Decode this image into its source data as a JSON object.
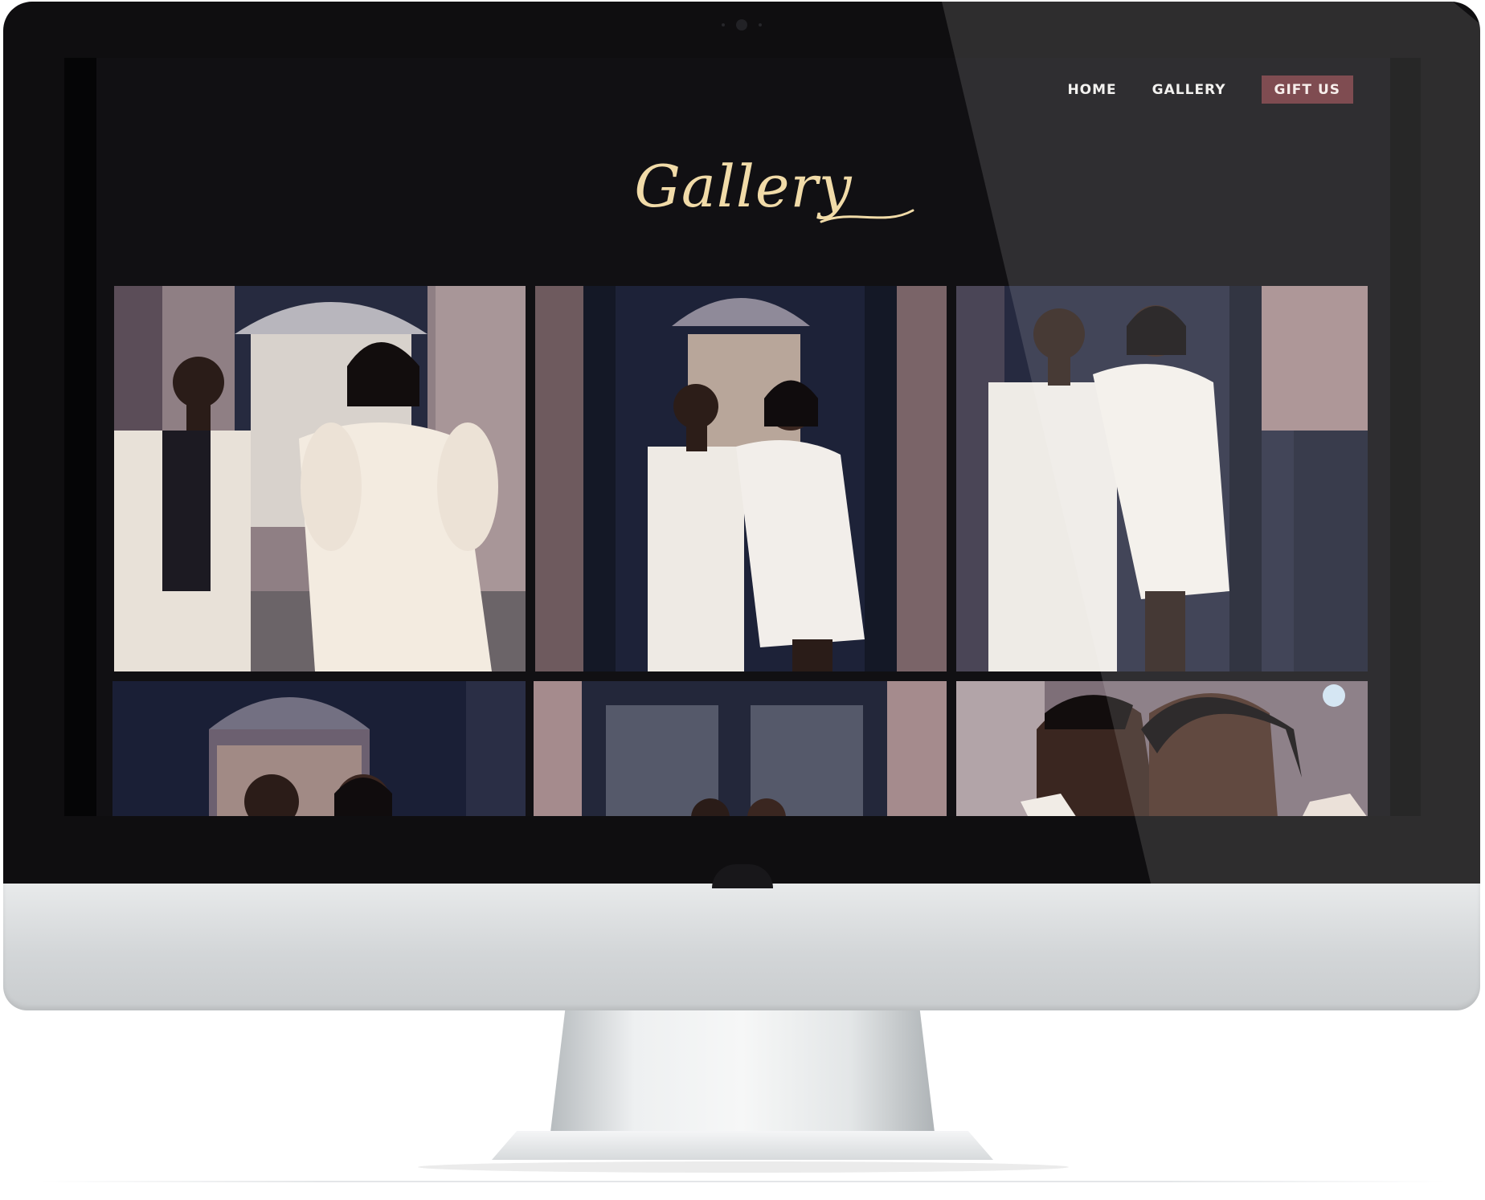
{
  "nav": {
    "links": [
      {
        "label": "HOME"
      },
      {
        "label": "GALLERY"
      }
    ],
    "cta": {
      "label": "GIFT US"
    }
  },
  "gallery": {
    "title": "Gallery",
    "title_color": "#f1dba8",
    "photos": [
      {
        "name": "couple-walking-hand-in-hand"
      },
      {
        "name": "couple-embrace-doorway"
      },
      {
        "name": "couple-standing-side-by-side"
      },
      {
        "name": "couple-portrait-doorway"
      },
      {
        "name": "couple-doorway-brick"
      },
      {
        "name": "couple-forehead-closeup"
      }
    ]
  },
  "colors": {
    "page_background": "#111013",
    "cta_background": "#6d3238",
    "nav_text": "#f2f0ee"
  }
}
